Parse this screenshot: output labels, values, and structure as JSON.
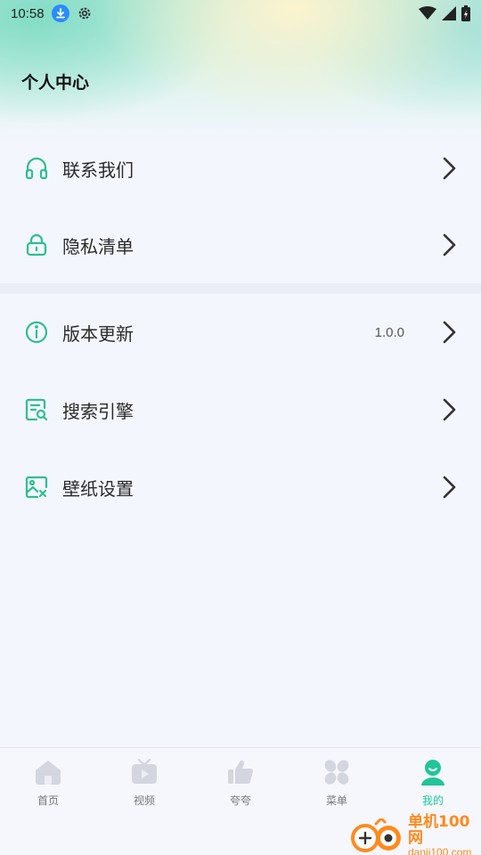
{
  "status_bar": {
    "time": "10:58"
  },
  "header": {
    "title": "个人中心"
  },
  "group1": [
    {
      "label": "联系我们",
      "icon": "headset-icon"
    },
    {
      "label": "隐私清单",
      "icon": "lock-icon"
    }
  ],
  "group2": [
    {
      "label": "版本更新",
      "value": "1.0.0",
      "icon": "info-icon"
    },
    {
      "label": "搜索引擎",
      "icon": "document-search-icon"
    },
    {
      "label": "壁纸设置",
      "icon": "wallpaper-icon"
    }
  ],
  "tabs": [
    {
      "label": "首页",
      "icon": "home-icon"
    },
    {
      "label": "视频",
      "icon": "tv-icon"
    },
    {
      "label": "夸夸",
      "icon": "thumbs-up-icon"
    },
    {
      "label": "菜单",
      "icon": "menu-grid-icon"
    },
    {
      "label": "我的",
      "icon": "user-icon",
      "active": true
    }
  ],
  "watermark": {
    "brand": "单机100网",
    "domain": "danji100.com"
  },
  "colors": {
    "accent": "#22c59a",
    "icon_green": "#2fbf8f",
    "background": "#f4f6fd",
    "tab_inactive": "#d3d6de",
    "watermark": "#ff8a1e"
  }
}
